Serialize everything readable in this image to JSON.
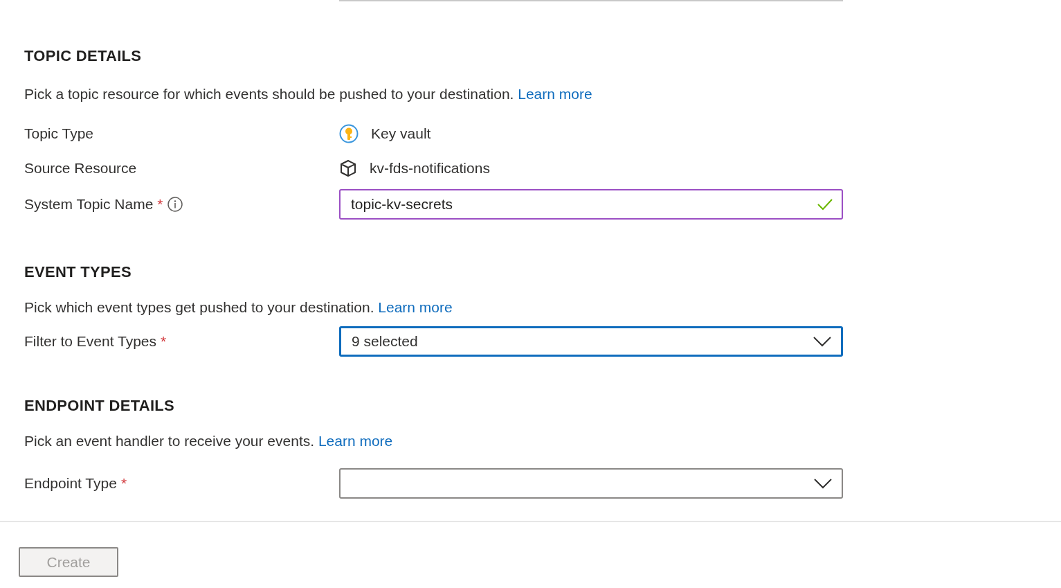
{
  "sections": [
    {
      "title": "TOPIC DETAILS",
      "description": "Pick a topic resource for which events should be pushed to your destination.",
      "link": "Learn more",
      "fields": [
        {
          "kind": "topic-type",
          "label": "Topic Type",
          "value": "Key vault"
        },
        {
          "kind": "source",
          "label": "Source Resource",
          "value": "kv-fds-notifications"
        },
        {
          "kind": "text",
          "label": "System Topic Name",
          "required_mark": "*",
          "info": true,
          "value": "topic-kv-secrets",
          "valid": true
        }
      ]
    },
    {
      "title": "EVENT TYPES",
      "description": "Pick which event types get pushed to your destination.",
      "link": "Learn more",
      "fields": [
        {
          "kind": "select",
          "label": "Filter to Event Types",
          "required_mark": "*",
          "value": "9 selected",
          "focused": true
        }
      ]
    },
    {
      "title": "ENDPOINT DETAILS",
      "description": "Pick an event handler to receive your events.",
      "link": "Learn more",
      "fields": [
        {
          "kind": "select",
          "label": "Endpoint Type",
          "required_mark": "*"
        }
      ]
    }
  ],
  "footer": {
    "button": {
      "label": "Create",
      "disabled": true
    }
  }
}
